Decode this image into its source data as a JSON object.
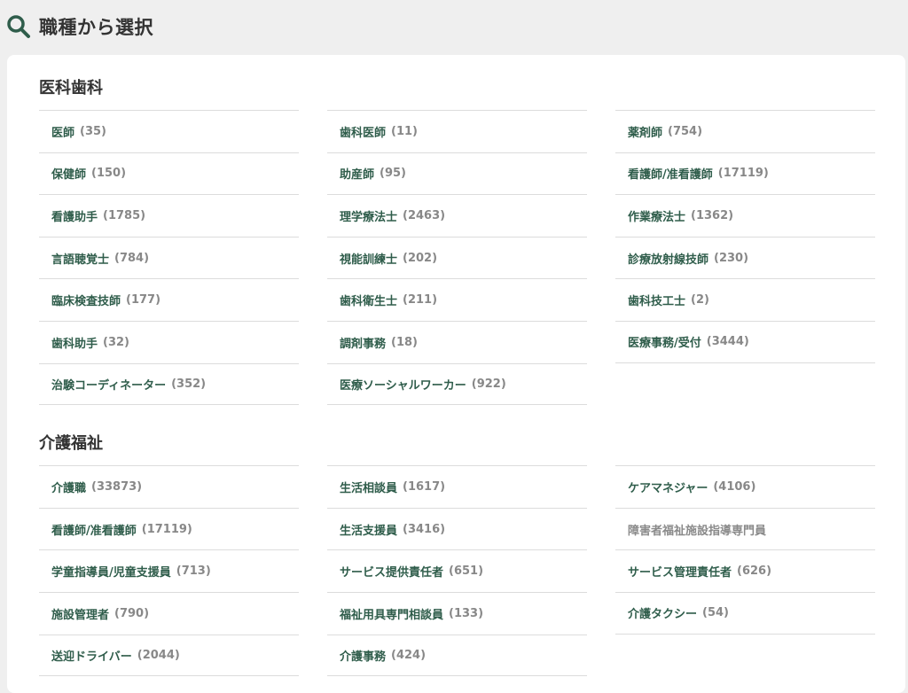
{
  "page": {
    "title": "職種から選択",
    "icon": "search-icon",
    "accent": "#2f5d4b"
  },
  "sections": [
    {
      "title": "医科歯科",
      "columns": [
        [
          {
            "name": "医師",
            "count": "(35)"
          },
          {
            "name": "保健師",
            "count": "(150)"
          },
          {
            "name": "看護助手",
            "count": "(1785)"
          },
          {
            "name": "言語聴覚士",
            "count": "(784)"
          },
          {
            "name": "臨床検査技師",
            "count": "(177)"
          },
          {
            "name": "歯科助手",
            "count": "(32)"
          },
          {
            "name": "治験コーディネーター",
            "count": "(352)"
          }
        ],
        [
          {
            "name": "歯科医師",
            "count": "(11)"
          },
          {
            "name": "助産師",
            "count": "(95)"
          },
          {
            "name": "理学療法士",
            "count": "(2463)"
          },
          {
            "name": "視能訓練士",
            "count": "(202)"
          },
          {
            "name": "歯科衛生士",
            "count": "(211)"
          },
          {
            "name": "調剤事務",
            "count": "(18)"
          },
          {
            "name": "医療ソーシャルワーカー",
            "count": "(922)"
          }
        ],
        [
          {
            "name": "薬剤師",
            "count": "(754)"
          },
          {
            "name": "看護師/准看護師",
            "count": "(17119)"
          },
          {
            "name": "作業療法士",
            "count": "(1362)"
          },
          {
            "name": "診療放射線技師",
            "count": "(230)"
          },
          {
            "name": "歯科技工士",
            "count": "(2)"
          },
          {
            "name": "医療事務/受付",
            "count": "(3444)"
          }
        ]
      ]
    },
    {
      "title": "介護福祉",
      "columns": [
        [
          {
            "name": "介護職",
            "count": "(33873)"
          },
          {
            "name": "看護師/准看護師",
            "count": "(17119)"
          },
          {
            "name": "学童指導員/児童支援員",
            "count": "(713)"
          },
          {
            "name": "施設管理者",
            "count": "(790)"
          },
          {
            "name": "送迎ドライバー",
            "count": "(2044)"
          }
        ],
        [
          {
            "name": "生活相談員",
            "count": "(1617)"
          },
          {
            "name": "生活支援員",
            "count": "(3416)"
          },
          {
            "name": "サービス提供責任者",
            "count": "(651)"
          },
          {
            "name": "福祉用具専門相談員",
            "count": "(133)"
          },
          {
            "name": "介護事務",
            "count": "(424)"
          }
        ],
        [
          {
            "name": "ケアマネジャー",
            "count": "(4106)"
          },
          {
            "name": "障害者福祉施設指導専門員",
            "count": "",
            "disabled": true
          },
          {
            "name": "サービス管理責任者",
            "count": "(626)"
          },
          {
            "name": "介護タクシー",
            "count": "(54)"
          }
        ]
      ]
    }
  ]
}
